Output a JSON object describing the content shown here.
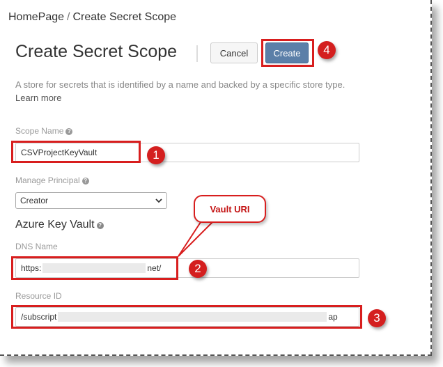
{
  "breadcrumb": {
    "home": "HomePage",
    "separator": "/",
    "current": "Create Secret Scope"
  },
  "header": {
    "title": "Create Secret Scope",
    "cancel_label": "Cancel",
    "create_label": "Create"
  },
  "description": {
    "text": "A store for secrets that is identified by a name and backed by a specific store type.",
    "link": "Learn more"
  },
  "form": {
    "scope_name_label": "Scope Name",
    "scope_name_value": "CSVProjectKeyVault",
    "manage_principal_label": "Manage Principal",
    "manage_principal_value": "Creator",
    "azure_section_title": "Azure Key Vault",
    "dns_name_label": "DNS Name",
    "dns_prefix": "https:",
    "dns_suffix": "net/",
    "resource_id_label": "Resource ID",
    "resource_prefix": "/subscript",
    "resource_suffix": "ap"
  },
  "annotations": {
    "callout": "Vault URI",
    "badges": [
      "1",
      "2",
      "3",
      "4"
    ],
    "accent_color": "#d81e1e"
  },
  "icons": {
    "help": "help-circle-icon",
    "dropdown": "chevron-down-icon"
  }
}
